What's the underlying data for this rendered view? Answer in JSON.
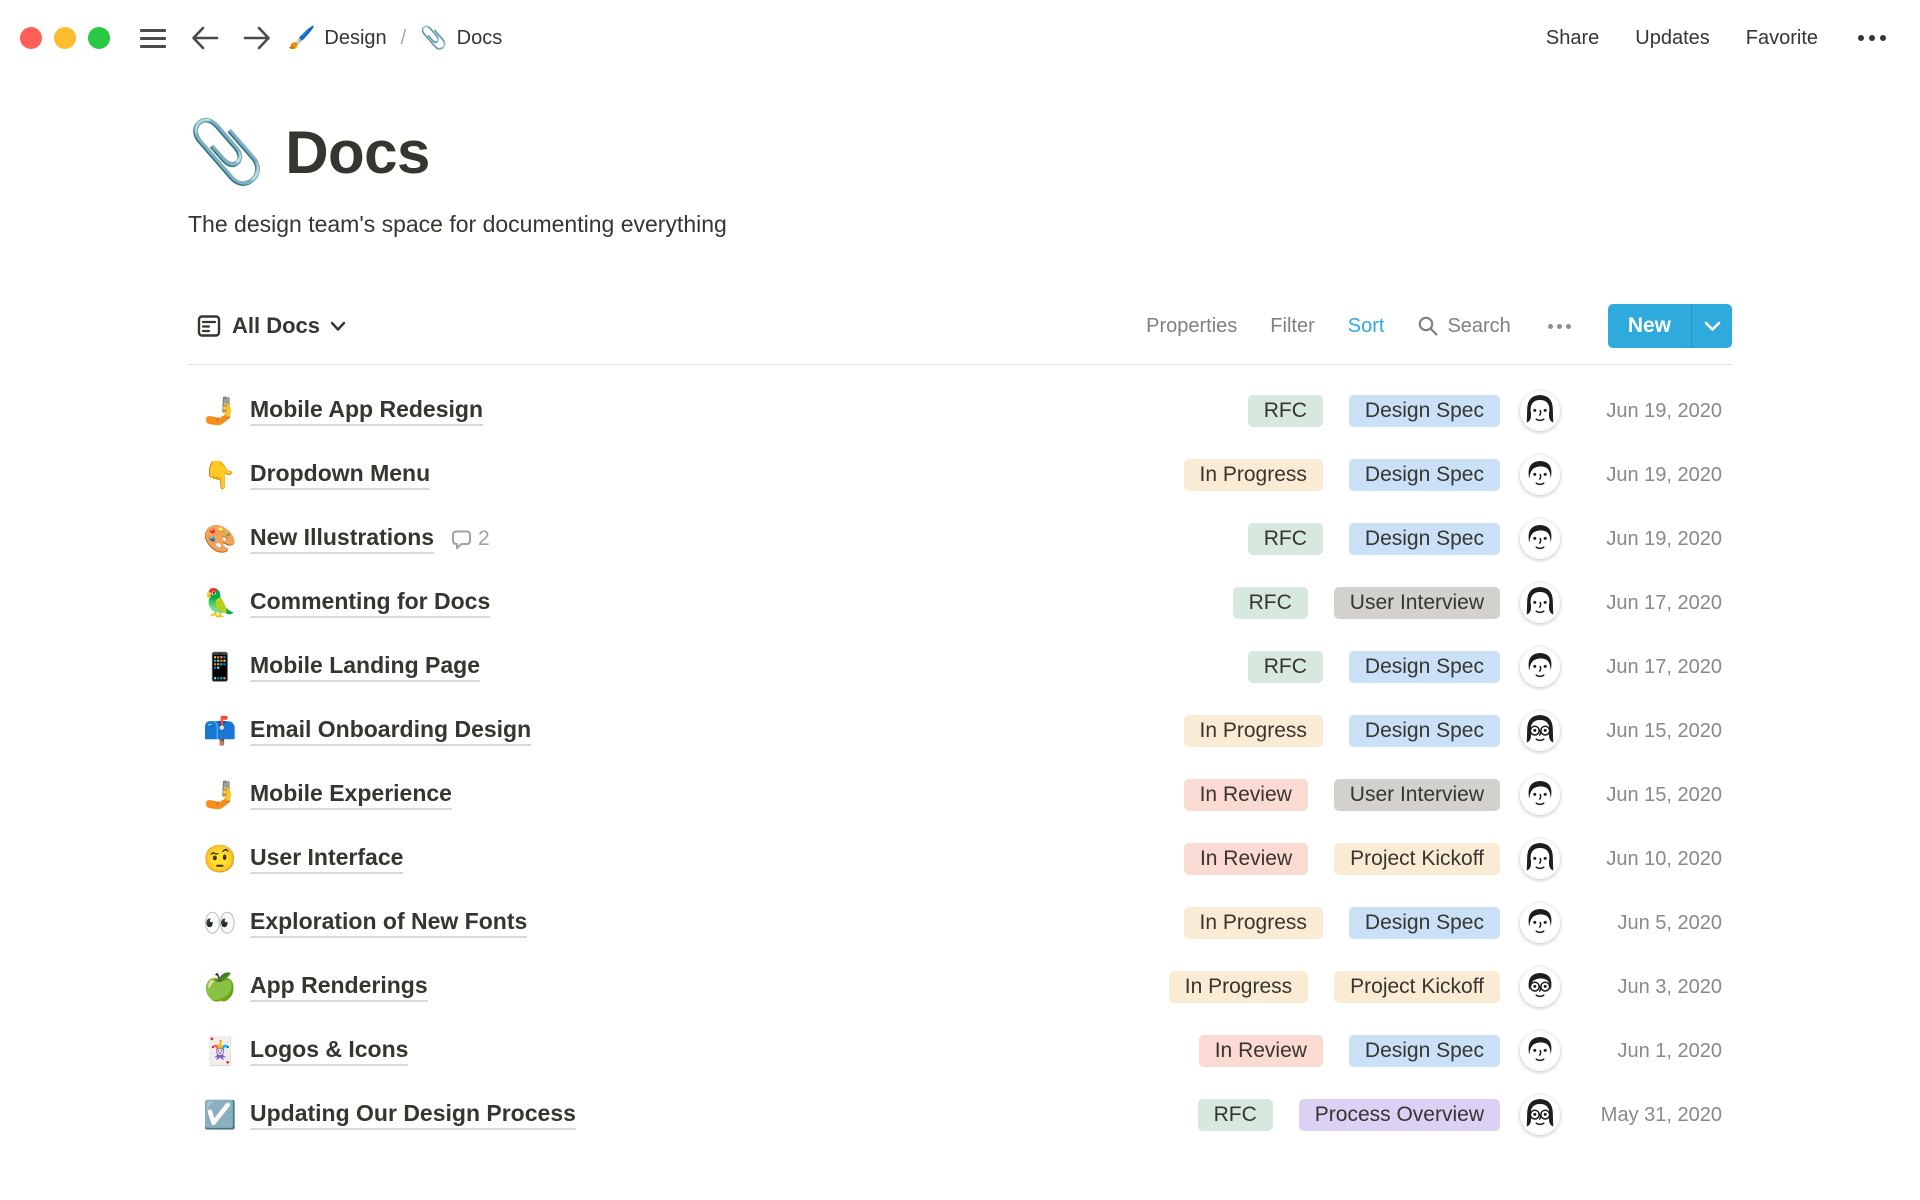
{
  "header": {
    "breadcrumb": {
      "app_icon": "🖌️",
      "app_label": "Design",
      "separator": "/",
      "page_icon": "📎",
      "page_label": "Docs"
    },
    "share_label": "Share",
    "updates_label": "Updates",
    "favorite_label": "Favorite"
  },
  "page": {
    "icon": "📎",
    "title": "Docs",
    "subtitle": "The design team's space for documenting everything"
  },
  "toolbar": {
    "view_label": "All Docs",
    "properties_label": "Properties",
    "filter_label": "Filter",
    "sort_label": "Sort",
    "search_label": "Search",
    "new_label": "New"
  },
  "colors": {
    "accent": "#2EAADC",
    "traffic_red": "#FF5F57",
    "traffic_yellow": "#FEBC2E",
    "traffic_green": "#28C840",
    "tag_green": "#D7E8DE",
    "tag_blue": "#C9E0F7",
    "tag_yellow": "#FAEBD4",
    "tag_gray": "#D2D1CD",
    "tag_pink": "#FADAD3",
    "tag_purple": "#DCD0F5"
  },
  "table": {
    "rows": [
      {
        "icon": "🤳",
        "title": "Mobile App Redesign",
        "status": "RFC",
        "status_color": "green",
        "type": "Design Spec",
        "type_color": "blue",
        "avatar": "woman",
        "date": "Jun 19, 2020"
      },
      {
        "icon": "👇",
        "title": "Dropdown Menu",
        "status": "In Progress",
        "status_color": "yellow",
        "type": "Design Spec",
        "type_color": "blue",
        "avatar": "man",
        "date": "Jun 19, 2020"
      },
      {
        "icon": "🎨",
        "title": "New Illustrations",
        "comments": "2",
        "status": "RFC",
        "status_color": "green",
        "type": "Design Spec",
        "type_color": "blue",
        "avatar": "man",
        "date": "Jun 19, 2020"
      },
      {
        "icon": "🦜",
        "title": "Commenting for Docs",
        "status": "RFC",
        "status_color": "green",
        "type": "User Interview",
        "type_color": "gray",
        "avatar": "woman",
        "date": "Jun 17, 2020"
      },
      {
        "icon": "📱",
        "title": "Mobile Landing Page",
        "status": "RFC",
        "status_color": "green",
        "type": "Design Spec",
        "type_color": "blue",
        "avatar": "man",
        "date": "Jun 17, 2020"
      },
      {
        "icon": "📫",
        "title": "Email Onboarding Design",
        "status": "In Progress",
        "status_color": "yellow",
        "type": "Design Spec",
        "type_color": "blue",
        "avatar": "woman-glasses",
        "date": "Jun 15, 2020"
      },
      {
        "icon": "🤳",
        "title": "Mobile Experience",
        "status": "In Review",
        "status_color": "pink",
        "type": "User Interview",
        "type_color": "gray",
        "avatar": "man",
        "date": "Jun 15, 2020"
      },
      {
        "icon": "🤨",
        "title": "User Interface",
        "status": "In Review",
        "status_color": "pink",
        "type": "Project Kickoff",
        "type_color": "yellow",
        "avatar": "woman",
        "date": "Jun 10, 2020"
      },
      {
        "icon": "👀",
        "title": "Exploration of New Fonts",
        "status": "In Progress",
        "status_color": "yellow",
        "type": "Design Spec",
        "type_color": "blue",
        "avatar": "man",
        "date": "Jun 5, 2020"
      },
      {
        "icon": "🍏",
        "title": "App Renderings",
        "status": "In Progress",
        "status_color": "yellow",
        "type": "Project Kickoff",
        "type_color": "yellow",
        "avatar": "man-glasses",
        "date": "Jun 3, 2020"
      },
      {
        "icon": "🃏",
        "title": "Logos & Icons",
        "status": "In Review",
        "status_color": "pink",
        "type": "Design Spec",
        "type_color": "blue",
        "avatar": "man",
        "date": "Jun 1, 2020"
      },
      {
        "icon": "☑️",
        "title": "Updating Our Design Process",
        "status": "RFC",
        "status_color": "green",
        "type": "Process Overview",
        "type_color": "purple",
        "avatar": "woman-glasses",
        "date": "May 31, 2020"
      }
    ]
  }
}
